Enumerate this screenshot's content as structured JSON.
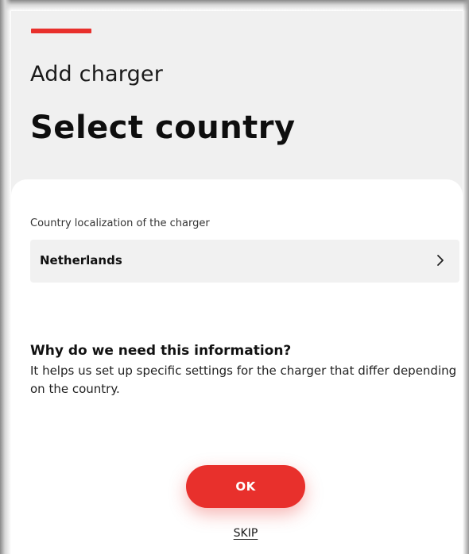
{
  "header": {
    "subtitle": "Add charger",
    "title": "Select country"
  },
  "country_field": {
    "label": "Country localization of the charger",
    "value": "Netherlands",
    "icon": "chevron-right-icon"
  },
  "info": {
    "heading": "Why do we need this information?",
    "body": "It helps us set up specific settings for the charger that differ depending on the country."
  },
  "actions": {
    "ok_label": "OK",
    "skip_label": "SKIP"
  },
  "colors": {
    "accent": "#e8302c",
    "background": "#f0f0f0",
    "card": "#ffffff",
    "field": "#f1f1f1"
  }
}
